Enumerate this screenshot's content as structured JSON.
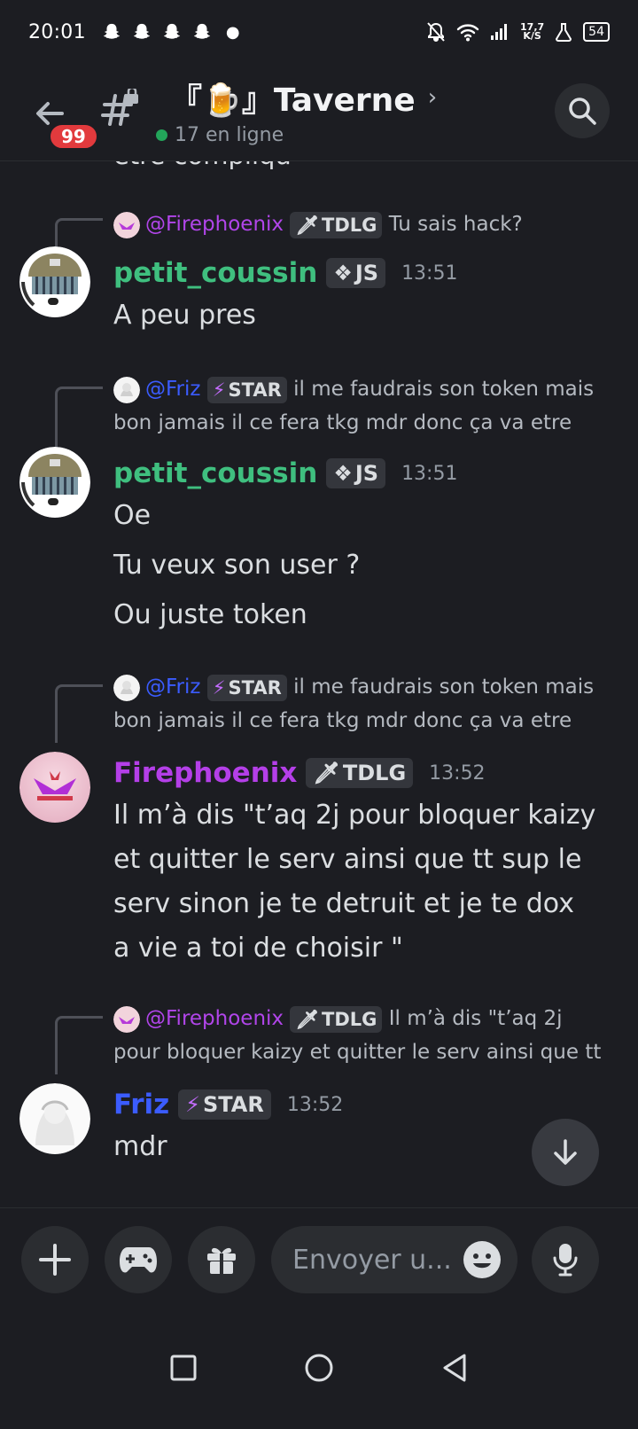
{
  "status_bar": {
    "time": "20:01",
    "speed_value": "17,7",
    "speed_unit": "K/S",
    "battery": "54"
  },
  "header": {
    "unread_badge": "99",
    "channel_name": "『🍺』Taverne",
    "online_text": "17 en ligne"
  },
  "cut_text": "etre compliqu",
  "messages": [
    {
      "reply": {
        "mention": "@Firephoenix",
        "mention_color": "#b145ea",
        "role": "TDLG",
        "role_icon": "sword-icon",
        "text_line1": "Tu sais hack?",
        "text_line2": ""
      },
      "author": "petit_coussin",
      "author_color": "#3fbf7f",
      "role": "JS",
      "role_icon": "diamond-icon",
      "time": "13:51",
      "lines": [
        "A peu pres"
      ]
    },
    {
      "reply": {
        "mention": "@Friz",
        "mention_color": "#3b5cff",
        "role": "STAR",
        "role_icon": "lightning-icon",
        "text_line1": "il me faudrais son token mais",
        "text_line2": "bon jamais il ce fera tkg mdr donc ça va etre"
      },
      "author": "petit_coussin",
      "author_color": "#3fbf7f",
      "role": "JS",
      "role_icon": "diamond-icon",
      "time": "13:51",
      "lines": [
        "Oe",
        "Tu veux son user ?",
        "Ou juste token"
      ]
    },
    {
      "reply": {
        "mention": "@Friz",
        "mention_color": "#3b5cff",
        "role": "STAR",
        "role_icon": "lightning-icon",
        "text_line1": "il me faudrais son token mais",
        "text_line2": "bon jamais il ce fera tkg mdr donc ça va etre"
      },
      "author": "Firephoenix",
      "author_color": "#b43fe8",
      "role": "TDLG",
      "role_icon": "sword-icon",
      "time": "13:52",
      "lines": [
        "Il m’à dis \"t’aq 2j pour bloquer kaizy",
        "et quitter le serv ainsi que tt sup le",
        "serv  sinon je te detruit et je te  dox",
        "a vie a toi de choisir \""
      ]
    },
    {
      "reply": {
        "mention": "@Firephoenix",
        "mention_color": "#b145ea",
        "role": "TDLG",
        "role_icon": "sword-icon",
        "text_line1": "Il m’à dis \"t’aq 2j",
        "text_line2": "pour bloquer kaizy et quitter le serv ainsi que tt"
      },
      "author": "Friz",
      "author_color": "#3b5cff",
      "role": "STAR",
      "role_icon": "lightning-icon",
      "time": "13:52",
      "lines": [
        "mdr"
      ]
    }
  ],
  "composer": {
    "placeholder": "Envoyer u..."
  }
}
